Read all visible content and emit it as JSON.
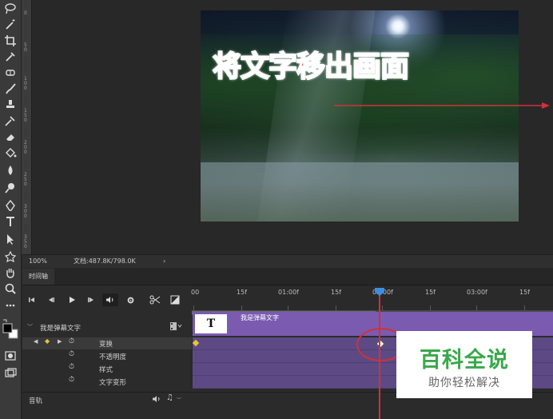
{
  "canvas": {
    "overlay_text": "将文字移出画面"
  },
  "ruler_ticks": [
    "0",
    "5\n0",
    "1\n0\n0",
    "1\n5\n0",
    "2\n0\n0",
    "2\n5\n0",
    "3\n0\n0",
    "3\n5\n0"
  ],
  "status": {
    "zoom": "100%",
    "doc_info": "文档:487.8K/798.0K",
    "arrow": "›"
  },
  "timeline": {
    "tab_label": "时间轴",
    "ruler_labels": [
      "00",
      "15f",
      "01:00f",
      "15f",
      "02:00f",
      "15f",
      "03:00f",
      "15f"
    ],
    "layer_group": "我是弹幕文字",
    "clip_name": "我是弹幕文字",
    "clip_thumb_text": "T",
    "properties": [
      "变换",
      "不透明度",
      "样式",
      "文字变形"
    ],
    "audio_label": "音轨"
  },
  "watermark": {
    "title": "百科全说",
    "subtitle": "助你轻松解决"
  },
  "colors": {
    "clip": "#7a5bb0",
    "playhead": "#d3303a",
    "overlay_text": "#d8232a",
    "watermark_green": "#3aa84a"
  }
}
